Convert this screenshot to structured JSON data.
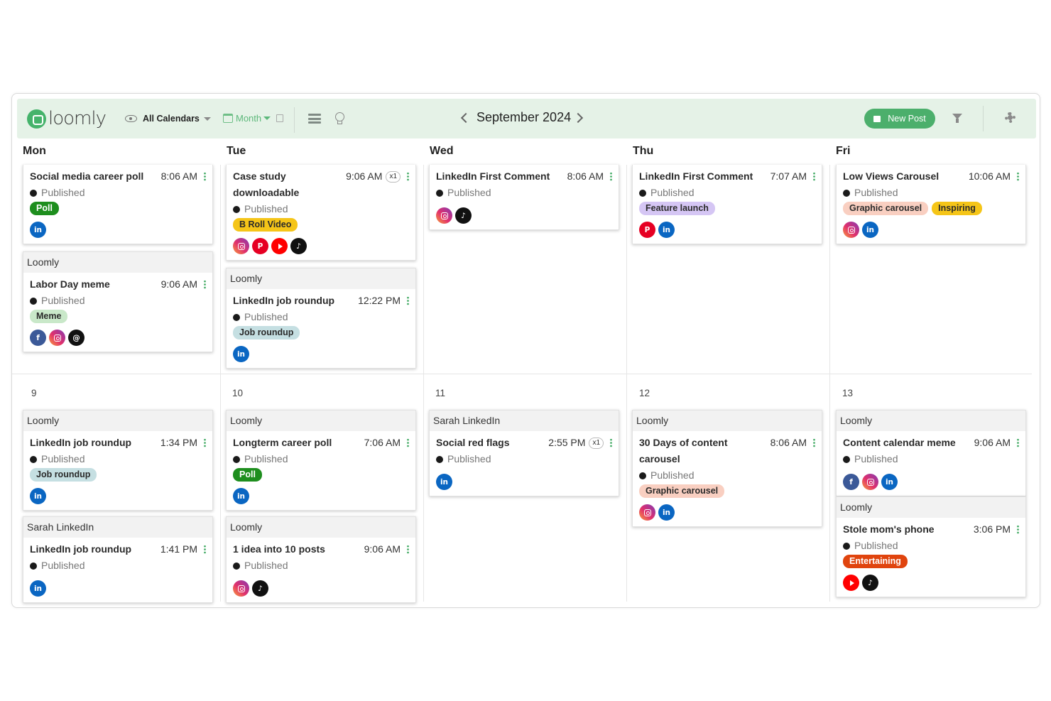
{
  "toolbar": {
    "logo_text": "loomly",
    "calendars_label": "All Calendars",
    "view_label": "Month",
    "month_title": "September 2024",
    "new_post_label": "New Post"
  },
  "colors": {
    "brand_green": "#4caf6c",
    "toolbar_bg": "#e5f2e7"
  },
  "days": [
    "Mon",
    "Tue",
    "Wed",
    "Thu",
    "Fri"
  ],
  "dates": [
    "9",
    "10",
    "11",
    "12",
    "13"
  ],
  "posts": {
    "mon1": {
      "title": "Social media career poll",
      "time": "8:06 AM",
      "status": "Published",
      "tags": [
        {
          "label": "Poll",
          "color": "#1e8e1e"
        }
      ],
      "networks": [
        "linkedin"
      ]
    },
    "mon2": {
      "calendar": "Loomly",
      "title": "Labor Day meme",
      "time": "9:06 AM",
      "status": "Published",
      "tags": [
        {
          "label": "Meme",
          "color": "#c9e8c9"
        }
      ],
      "networks": [
        "facebook",
        "instagram",
        "threads"
      ]
    },
    "tue1": {
      "title": "Case study downloadable",
      "time": "9:06 AM",
      "count": "x1",
      "status": "Published",
      "tags": [
        {
          "label": "B Roll Video",
          "color": "#f5c518"
        }
      ],
      "networks": [
        "instagram",
        "pinterest",
        "youtube",
        "tiktok"
      ]
    },
    "tue2": {
      "calendar": "Loomly",
      "title": "LinkedIn job roundup",
      "time": "12:22 PM",
      "status": "Published",
      "tags": [
        {
          "label": "Job roundup",
          "color": "#c5dfe2"
        }
      ],
      "networks": [
        "linkedin"
      ]
    },
    "wed1": {
      "title": "LinkedIn First Comment",
      "time": "8:06 AM",
      "status": "Published",
      "tags": [],
      "networks": [
        "instagram",
        "tiktok"
      ]
    },
    "thu1": {
      "title": "LinkedIn First Comment",
      "time": "7:07 AM",
      "status": "Published",
      "tags": [
        {
          "label": "Feature launch",
          "color": "#d5c6f4"
        }
      ],
      "networks": [
        "pinterest",
        "linkedin"
      ]
    },
    "fri1": {
      "title": "Low Views Carousel",
      "time": "10:06 AM",
      "status": "Published",
      "tags": [
        {
          "label": "Graphic carousel",
          "color": "#f9cfc1"
        },
        {
          "label": "Inspiring",
          "color": "#f5c518"
        }
      ],
      "networks": [
        "instagram",
        "linkedin"
      ]
    },
    "mon9a": {
      "calendar": "Loomly",
      "title": "LinkedIn job roundup",
      "time": "1:34 PM",
      "status": "Published",
      "tags": [
        {
          "label": "Job roundup",
          "color": "#c5dfe2"
        }
      ],
      "networks": [
        "linkedin"
      ]
    },
    "mon9b": {
      "calendar": "Sarah LinkedIn",
      "title": "LinkedIn job roundup",
      "time": "1:41 PM",
      "status": "Published",
      "tags": [],
      "networks": [
        "linkedin"
      ]
    },
    "tue10a": {
      "calendar": "Loomly",
      "title": "Longterm career poll",
      "time": "7:06 AM",
      "status": "Published",
      "tags": [
        {
          "label": "Poll",
          "color": "#1e8e1e"
        }
      ],
      "networks": [
        "linkedin"
      ]
    },
    "tue10b": {
      "calendar": "Loomly",
      "title": "1 idea into 10 posts",
      "time": "9:06 AM",
      "status": "Published",
      "tags": [],
      "networks": [
        "instagram",
        "tiktok"
      ]
    },
    "wed11a": {
      "calendar": "Sarah LinkedIn",
      "title": "Social red flags",
      "time": "2:55 PM",
      "count": "x1",
      "status": "Published",
      "tags": [],
      "networks": [
        "linkedin"
      ]
    },
    "thu12a": {
      "calendar": "Loomly",
      "title": "30 Days of content carousel",
      "time": "8:06 AM",
      "status": "Published",
      "tags": [
        {
          "label": "Graphic carousel",
          "color": "#f9cfc1"
        }
      ],
      "networks": [
        "instagram",
        "linkedin"
      ]
    },
    "fri13a": {
      "calendar": "Loomly",
      "title": "Content calendar meme",
      "time": "9:06 AM",
      "status": "Published",
      "tags": [],
      "networks": [
        "facebook",
        "instagram",
        "linkedin"
      ]
    },
    "fri13b": {
      "calendar": "Loomly",
      "title": "Stole mom's phone",
      "time": "3:06 PM",
      "status": "Published",
      "tags": [
        {
          "label": "Entertaining",
          "color": "#e0440e"
        }
      ],
      "networks": [
        "youtube",
        "tiktok"
      ]
    }
  }
}
